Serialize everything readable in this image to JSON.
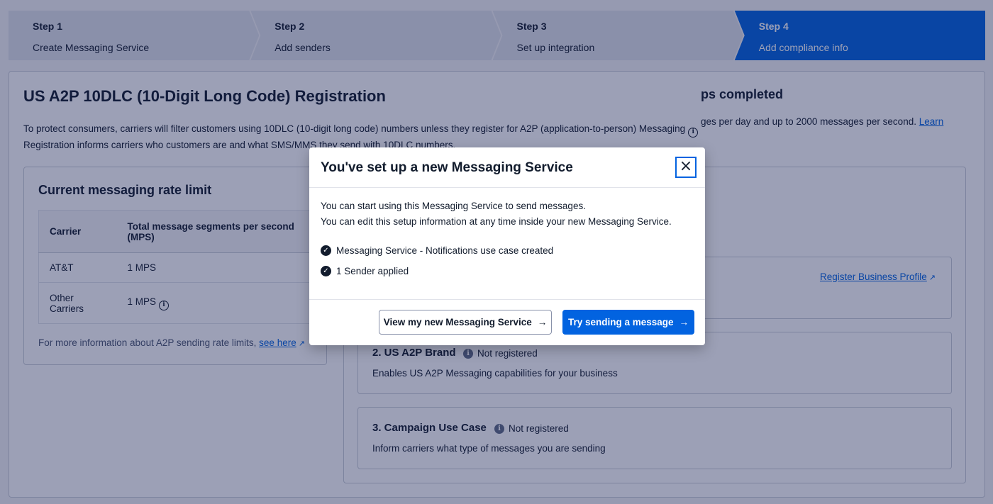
{
  "stepper": [
    {
      "step": "Step 1",
      "label": "Create Messaging Service",
      "active": false
    },
    {
      "step": "Step 2",
      "label": "Add senders",
      "active": false
    },
    {
      "step": "Step 3",
      "label": "Set up integration",
      "active": false
    },
    {
      "step": "Step 4",
      "label": "Add compliance info",
      "active": true
    }
  ],
  "page": {
    "title": "US A2P 10DLC (10-Digit Long Code) Registration",
    "intro_line1": "To protect consumers, carriers will filter customers using 10DLC (10-digit long code) numbers unless they register for A2P (application-to-person) Messaging",
    "intro_line2": "Registration informs carriers who customers are and what SMS/MMS they send with 10DLC numbers."
  },
  "rate_panel": {
    "title": "Current messaging rate limit",
    "headers": [
      "Carrier",
      "Total message segments per second (MPS)"
    ],
    "rows": [
      {
        "carrier": "AT&T",
        "mps": "1 MPS"
      },
      {
        "carrier": "Other Carriers",
        "mps": "1 MPS"
      }
    ],
    "footer_text": "For more information about A2P sending rate limits,",
    "footer_link": "see here"
  },
  "reg_panel": {
    "title_fragment": "ps completed",
    "desc_fragment": "ges per day and up to 2000 messages per second.",
    "desc_link": "Learn",
    "cards": [
      {
        "title": "",
        "status": "",
        "desc": "",
        "action": "Register Business Profile"
      },
      {
        "title": "2. US A2P Brand",
        "status": "Not registered",
        "desc": "Enables US A2P Messaging capabilities for your business"
      },
      {
        "title": "3. Campaign Use Case",
        "status": "Not registered",
        "desc": "Inform carriers what type of messages you are sending"
      }
    ]
  },
  "modal": {
    "title": "You've set up a new Messaging Service",
    "close": "×",
    "body_line1": "You can start using this Messaging Service to send messages.",
    "body_line2": "You can edit this setup information at any time inside your new Messaging Service.",
    "checks": [
      "Messaging Service - Notifications use case created",
      "1 Sender applied"
    ],
    "secondary_button": "View my new Messaging Service",
    "primary_button": "Try sending a message",
    "arrow": "→"
  },
  "colors": {
    "primary": "#0263e0",
    "overlay": "#121c50",
    "text": "#121c2d"
  },
  "icons": [
    "info-icon",
    "check-circle-icon",
    "external-link-icon",
    "close-icon",
    "arrow-right-icon"
  ]
}
